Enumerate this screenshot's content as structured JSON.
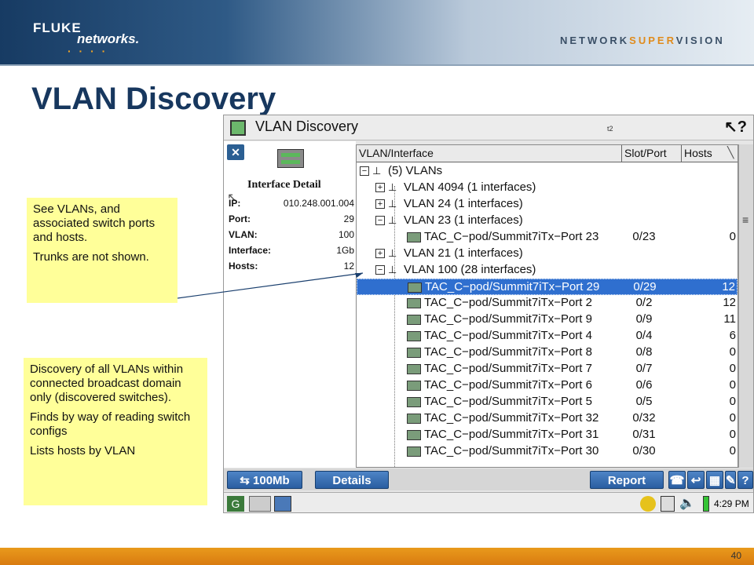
{
  "header": {
    "logo_fluke": "FLUKE",
    "logo_networks": "networks.",
    "tagline_a": "NETWORK",
    "tagline_b": "SUPER",
    "tagline_c": "VISION"
  },
  "slide": {
    "title": "VLAN Discovery",
    "page_number": "40"
  },
  "window": {
    "title": "VLAN Discovery",
    "title_mark": "t2",
    "help_icon": "help-pointer-icon"
  },
  "detail": {
    "heading": "Interface Detail",
    "fields": [
      {
        "label": "IP:",
        "value": "010.248.001.004"
      },
      {
        "label": "Port:",
        "value": "29"
      },
      {
        "label": "VLAN:",
        "value": "100"
      },
      {
        "label": "Interface:",
        "value": "1Gb"
      },
      {
        "label": "Hosts:",
        "value": "12"
      }
    ]
  },
  "table": {
    "headers": [
      "VLAN/Interface",
      "Slot/Port",
      "Hosts"
    ],
    "rows": [
      {
        "text": "(5) VLANs",
        "type": "root",
        "exp": "−"
      },
      {
        "text": "VLAN 4094 (1 interfaces)",
        "type": "vlan",
        "exp": "+"
      },
      {
        "text": "VLAN 24 (1 interfaces)",
        "type": "vlan",
        "exp": "+"
      },
      {
        "text": "VLAN 23 (1 interfaces)",
        "type": "vlan",
        "exp": "−"
      },
      {
        "text": "TAC_C−pod/Summit7iTx−Port 23",
        "type": "port",
        "slot": "0/23",
        "hosts": "0"
      },
      {
        "text": "VLAN 21 (1 interfaces)",
        "type": "vlan",
        "exp": "+"
      },
      {
        "text": "VLAN 100 (28 interfaces)",
        "type": "vlan",
        "exp": "−"
      },
      {
        "text": "TAC_C−pod/Summit7iTx−Port 29",
        "type": "port",
        "slot": "0/29",
        "hosts": "12",
        "selected": true
      },
      {
        "text": "TAC_C−pod/Summit7iTx−Port 2",
        "type": "port",
        "slot": "0/2",
        "hosts": "12"
      },
      {
        "text": "TAC_C−pod/Summit7iTx−Port 9",
        "type": "port",
        "slot": "0/9",
        "hosts": "11"
      },
      {
        "text": "TAC_C−pod/Summit7iTx−Port 4",
        "type": "port",
        "slot": "0/4",
        "hosts": "6"
      },
      {
        "text": "TAC_C−pod/Summit7iTx−Port 8",
        "type": "port",
        "slot": "0/8",
        "hosts": "0"
      },
      {
        "text": "TAC_C−pod/Summit7iTx−Port 7",
        "type": "port",
        "slot": "0/7",
        "hosts": "0"
      },
      {
        "text": "TAC_C−pod/Summit7iTx−Port 6",
        "type": "port",
        "slot": "0/6",
        "hosts": "0"
      },
      {
        "text": "TAC_C−pod/Summit7iTx−Port 5",
        "type": "port",
        "slot": "0/5",
        "hosts": "0"
      },
      {
        "text": "TAC_C−pod/Summit7iTx−Port 32",
        "type": "port",
        "slot": "0/32",
        "hosts": "0"
      },
      {
        "text": "TAC_C−pod/Summit7iTx−Port 31",
        "type": "port",
        "slot": "0/31",
        "hosts": "0"
      },
      {
        "text": "TAC_C−pod/Summit7iTx−Port 30",
        "type": "port",
        "slot": "0/30",
        "hosts": "0"
      }
    ]
  },
  "toolbar": {
    "speed_label": "100Mb",
    "details_label": "Details",
    "report_label": "Report"
  },
  "statusbar": {
    "time": "4:29 PM"
  },
  "notes": {
    "note1": [
      "See VLANs, and associated switch ports and hosts.",
      "Trunks are not shown."
    ],
    "note2": [
      "Discovery of all VLANs within connected broadcast domain only (discovered switches).",
      "Finds by way of reading switch configs",
      "Lists hosts by VLAN"
    ]
  },
  "colors": {
    "accent_blue": "#17375e",
    "selection": "#2f6fcf",
    "note_bg": "#ffff99",
    "orange": "#e99a1c"
  }
}
